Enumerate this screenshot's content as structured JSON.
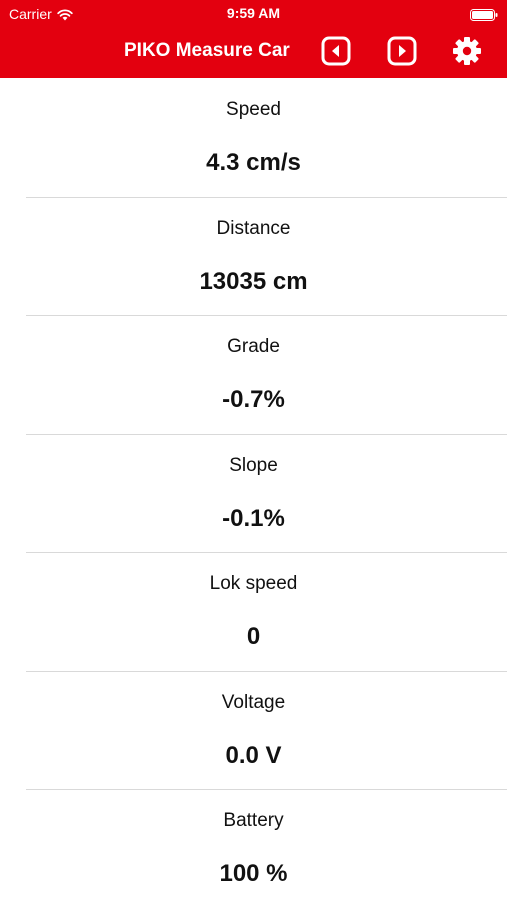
{
  "status_bar": {
    "carrier": "Carrier",
    "time": "9:59 AM"
  },
  "nav": {
    "title": "PIKO Measure Car",
    "prev_icon": "caret-left-square-icon",
    "next_icon": "caret-right-square-icon",
    "settings_icon": "gear-icon"
  },
  "colors": {
    "accent": "#e3000f",
    "divider": "#d9d9d9"
  },
  "measurements": [
    {
      "label": "Speed",
      "value": "4.3 cm/s"
    },
    {
      "label": "Distance",
      "value": "13035 cm"
    },
    {
      "label": "Grade",
      "value": "-0.7%"
    },
    {
      "label": "Slope",
      "value": "-0.1%"
    },
    {
      "label": "Lok speed",
      "value": "0"
    },
    {
      "label": "Voltage",
      "value": "0.0 V"
    },
    {
      "label": "Battery",
      "value": "100 %"
    }
  ]
}
